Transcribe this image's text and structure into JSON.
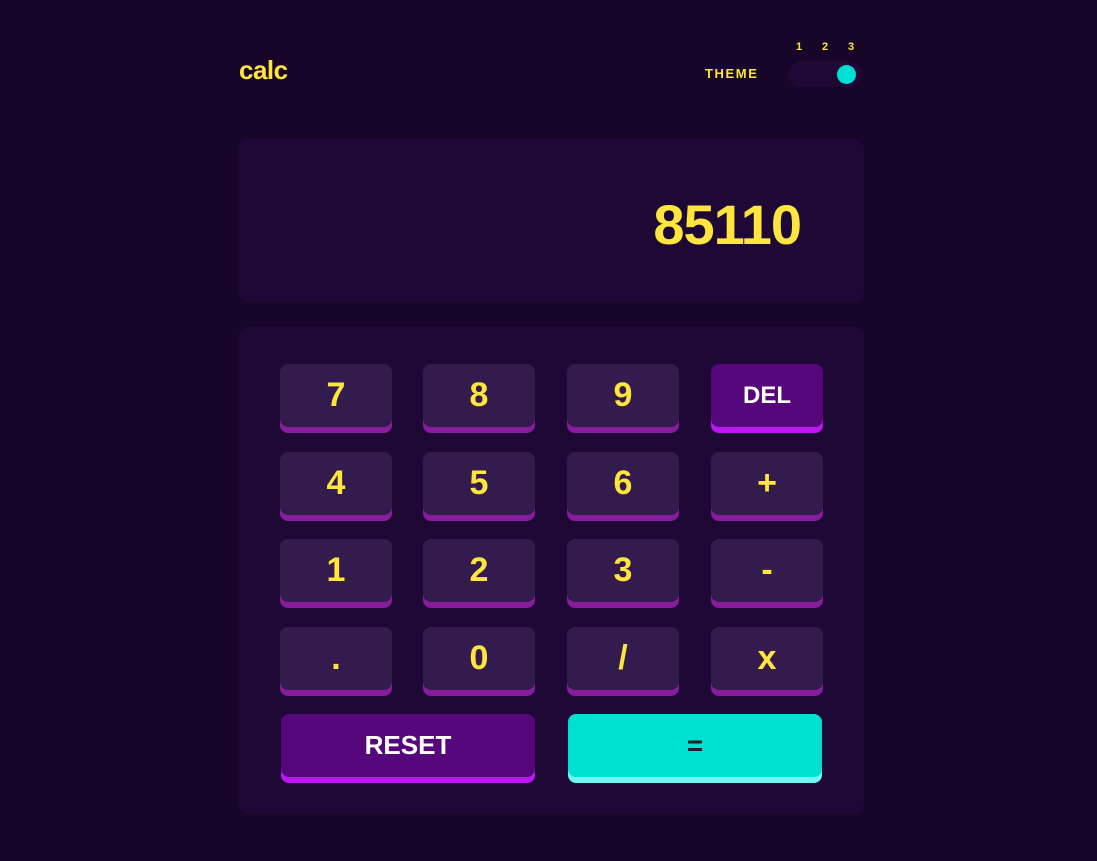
{
  "app": {
    "logo": "calc"
  },
  "theme": {
    "label": "THEME",
    "options": [
      "1",
      "2",
      "3"
    ],
    "selected": 3
  },
  "screen": {
    "value": "85110"
  },
  "keypad": {
    "keys": {
      "seven": "7",
      "eight": "8",
      "nine": "9",
      "del": "DEL",
      "four": "4",
      "five": "5",
      "six": "6",
      "plus": "+",
      "one": "1",
      "two": "2",
      "three": "3",
      "minus": "-",
      "dot": ".",
      "zero": "0",
      "divide": "/",
      "multiply": "x",
      "reset": "RESET",
      "equals": "="
    }
  },
  "colors": {
    "background": "#17062a",
    "panel": "#1e0836",
    "key": "#331c4d",
    "key_shadow": "#881c9e",
    "accent_text": "#ffe53d",
    "special_key": "#56077c",
    "special_key_shadow": "#be15f4",
    "equals_key": "#00e0d1",
    "equals_key_shadow": "#6cf9f2"
  }
}
